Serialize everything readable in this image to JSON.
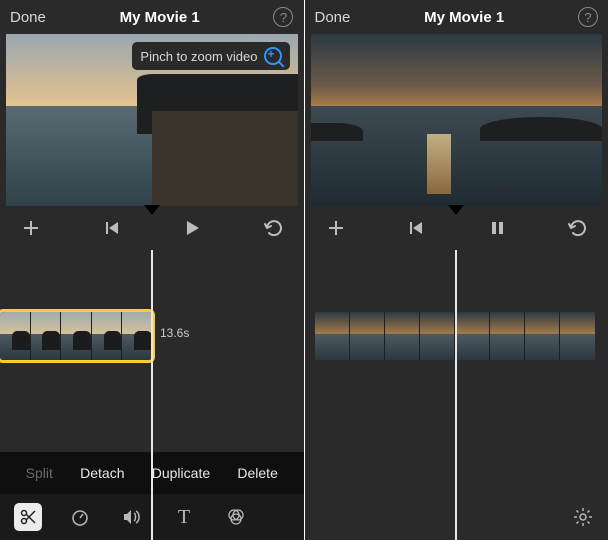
{
  "header": {
    "done": "Done",
    "title": "My Movie 1"
  },
  "tooltip": "Pinch to zoom video",
  "duration": "13.6s",
  "edit": {
    "split": "Split",
    "detach": "Detach",
    "duplicate": "Duplicate",
    "delete": "Delete"
  },
  "icons": {
    "help": "?",
    "text": "T",
    "add": "+"
  }
}
